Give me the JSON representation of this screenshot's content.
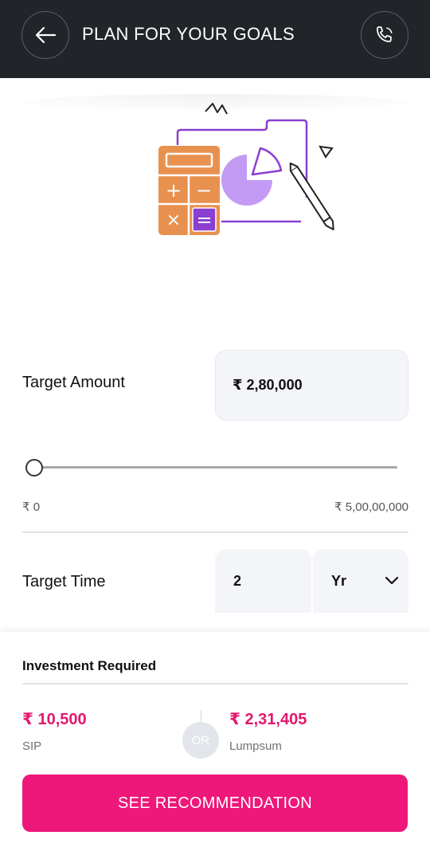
{
  "header": {
    "title": "PLAN FOR YOUR GOALS",
    "back_icon": "arrow-left-icon",
    "call_icon": "phone-icon",
    "background": "#212428"
  },
  "illustration": {
    "icon": "calculator-chart-illustration",
    "calculator_symbols": [
      "+",
      "−",
      "×",
      "="
    ]
  },
  "target_amount": {
    "label": "Target Amount",
    "value": "₹ 2,80,000"
  },
  "slider": {
    "min_label": "₹ 0",
    "max_label": "₹ 5,00,00,000",
    "level": 0.0056
  },
  "target_time": {
    "label": "Target Time",
    "years_value": "2",
    "unit_value": "Yr",
    "unit_icon": "chevron-down-icon"
  },
  "investment": {
    "title": "Investment Required",
    "sip_value": "₹ 10,500",
    "sip_label": "SIP",
    "or_text": "OR",
    "lumpsum_value": "₹ 2,31,405",
    "lumpsum_label": "Lumpsum"
  },
  "cta": {
    "label": "SEE RECOMMENDATION",
    "color": "#ee177a"
  },
  "colors": {
    "accent": "#e3176f",
    "purple": "#8a3fd1",
    "orange": "#e8914f"
  }
}
